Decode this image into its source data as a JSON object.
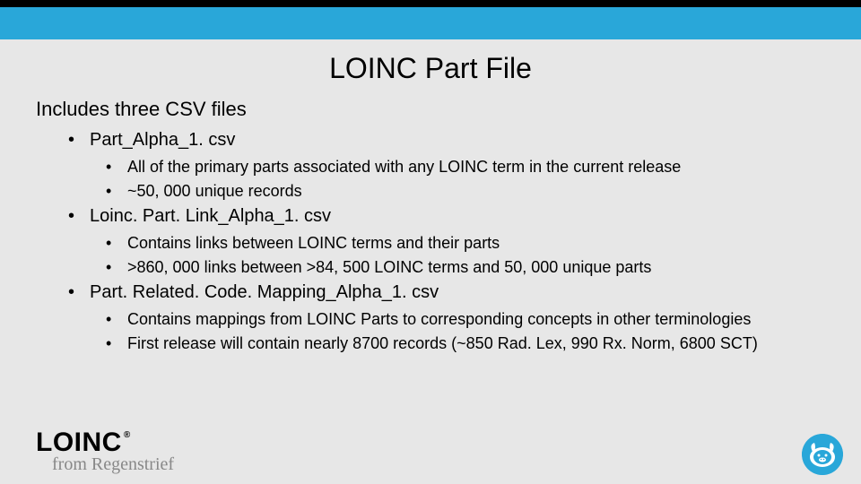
{
  "slide": {
    "title": "LOINC Part File",
    "subtitle": "Includes three CSV files",
    "files": [
      {
        "name": "Part_Alpha_1. csv",
        "details": [
          "All of the primary parts associated with any LOINC term in the current release",
          "~50, 000 unique records"
        ]
      },
      {
        "name": "Loinc. Part. Link_Alpha_1. csv",
        "details": [
          "Contains links between LOINC terms and their parts",
          ">860, 000 links between >84, 500 LOINC terms and 50, 000 unique parts"
        ]
      },
      {
        "name": "Part. Related. Code. Mapping_Alpha_1. csv",
        "details": [
          "Contains mappings from LOINC Parts to corresponding concepts in other terminologies",
          "First release will contain nearly 8700 records (~850 Rad. Lex, 990 Rx. Norm, 6800 SCT)"
        ]
      }
    ]
  },
  "footer": {
    "logo_text": "LOINC",
    "registered": "®",
    "tagline": "from Regenstrief"
  }
}
